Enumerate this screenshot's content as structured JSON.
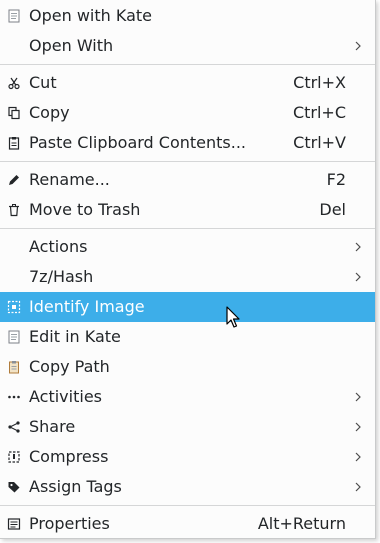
{
  "menu": {
    "items": [
      {
        "label": "Open with Kate",
        "shortcut": "",
        "submenu": false,
        "icon": "kate-document-icon"
      },
      {
        "label": "Open With",
        "shortcut": "",
        "submenu": true,
        "icon": ""
      },
      {
        "label": "Cut",
        "shortcut": "Ctrl+X",
        "submenu": false,
        "icon": "scissors-icon"
      },
      {
        "label": "Copy",
        "shortcut": "Ctrl+C",
        "submenu": false,
        "icon": "copy-icon"
      },
      {
        "label": "Paste Clipboard Contents...",
        "shortcut": "Ctrl+V",
        "submenu": false,
        "icon": "paste-icon"
      },
      {
        "label": "Rename...",
        "shortcut": "F2",
        "submenu": false,
        "icon": "pencil-icon"
      },
      {
        "label": "Move to Trash",
        "shortcut": "Del",
        "submenu": false,
        "icon": "trash-icon"
      },
      {
        "label": "Actions",
        "shortcut": "",
        "submenu": true,
        "icon": ""
      },
      {
        "label": "7z/Hash",
        "shortcut": "",
        "submenu": true,
        "icon": ""
      },
      {
        "label": "Identify Image",
        "shortcut": "",
        "submenu": false,
        "icon": "identify-image-icon",
        "highlighted": true
      },
      {
        "label": "Edit in Kate",
        "shortcut": "",
        "submenu": false,
        "icon": "kate-document-icon"
      },
      {
        "label": "Copy Path",
        "shortcut": "",
        "submenu": false,
        "icon": "clipboard-icon"
      },
      {
        "label": "Activities",
        "shortcut": "",
        "submenu": true,
        "icon": "dots-icon"
      },
      {
        "label": "Share",
        "shortcut": "",
        "submenu": true,
        "icon": "share-icon"
      },
      {
        "label": "Compress",
        "shortcut": "",
        "submenu": true,
        "icon": "compress-icon"
      },
      {
        "label": "Assign Tags",
        "shortcut": "",
        "submenu": true,
        "icon": "tag-icon"
      },
      {
        "label": "Properties",
        "shortcut": "Alt+Return",
        "submenu": false,
        "icon": "properties-icon"
      }
    ]
  },
  "colors": {
    "highlight": "#3daee9",
    "text": "#232629",
    "background": "#fcfcfc"
  }
}
